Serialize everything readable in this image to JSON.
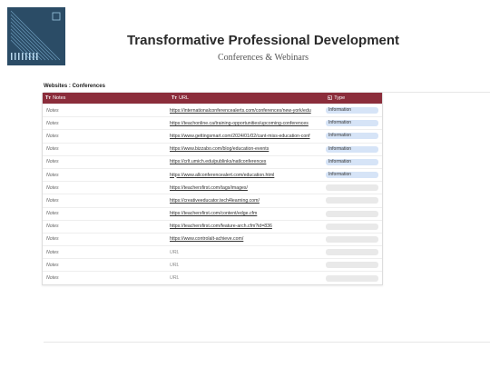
{
  "header": {
    "title": "Transformative Professional Development",
    "subtitle": "Conferences & Webinars",
    "logo_icon": "abstract-stripes-logo"
  },
  "section": {
    "label": "Websites : Conferences"
  },
  "table": {
    "columns": [
      {
        "icon": "Tт",
        "label": "Notes"
      },
      {
        "icon": "Tт",
        "label": "URL"
      },
      {
        "icon": "◱",
        "label": "Type"
      }
    ],
    "rows": [
      {
        "notes": "Notes",
        "url": "https://internationalconferencealerts.com/conferences/new-york/edu",
        "type": "Information"
      },
      {
        "notes": "Notes",
        "url": "https://teachonline.ca/training-opportunities/upcoming-conferences",
        "type": "Information"
      },
      {
        "notes": "Notes",
        "url": "https://www.gettingsmart.com/2024/01/02/cant-miss-education-conf",
        "type": "Information"
      },
      {
        "notes": "Notes",
        "url": "https://www.bizzabo.com/blog/education-events",
        "type": "Information"
      },
      {
        "notes": "Notes",
        "url": "https://crlt.umich.edu/publinks/natlconferences",
        "type": "Information"
      },
      {
        "notes": "Notes",
        "url": "https://www.allconferencealert.com/education.html",
        "type": "Information"
      },
      {
        "notes": "Notes",
        "url": "https://teachersfirst.com/tags/images/",
        "type": ""
      },
      {
        "notes": "Notes",
        "url": "https://creativeeducator.tech4learning.com/",
        "type": ""
      },
      {
        "notes": "Notes",
        "url": "https://teachersfirst.com/content/edge.cfm",
        "type": ""
      },
      {
        "notes": "Notes",
        "url": "https://teachersfirst.com/feature-arch.cfm?id=836",
        "type": ""
      },
      {
        "notes": "Notes",
        "url": "https://www.controlalt-achieve.com/",
        "type": ""
      },
      {
        "notes": "Notes",
        "url": "URL",
        "type": "",
        "url_placeholder": true
      },
      {
        "notes": "Notes",
        "url": "URL",
        "type": "",
        "url_placeholder": true
      },
      {
        "notes": "Notes",
        "url": "URL",
        "type": "",
        "url_placeholder": true
      }
    ]
  },
  "colors": {
    "header_bg": "#8b2d3b",
    "info_pill": "#d6e4f7",
    "empty_pill": "#e9e9e9",
    "logo_bg": "#2b4c66"
  }
}
